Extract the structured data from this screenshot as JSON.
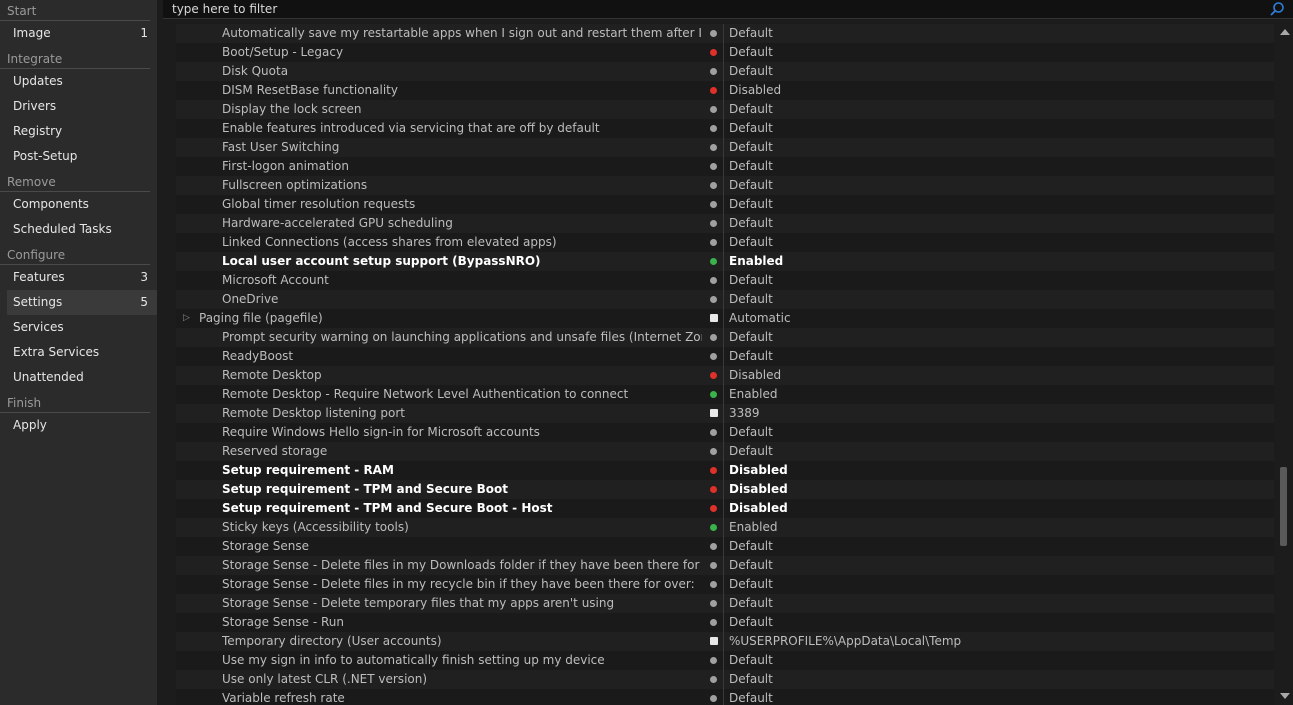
{
  "sidebar": {
    "groups": [
      {
        "header": "Start",
        "items": [
          {
            "label": "Image",
            "count": "1"
          }
        ]
      },
      {
        "header": "Integrate",
        "items": [
          {
            "label": "Updates"
          },
          {
            "label": "Drivers"
          },
          {
            "label": "Registry"
          },
          {
            "label": "Post-Setup"
          }
        ]
      },
      {
        "header": "Remove",
        "items": [
          {
            "label": "Components"
          },
          {
            "label": "Scheduled Tasks"
          }
        ]
      },
      {
        "header": "Configure",
        "items": [
          {
            "label": "Features",
            "count": "3"
          },
          {
            "label": "Settings",
            "count": "5",
            "active": true
          },
          {
            "label": "Services"
          },
          {
            "label": "Extra Services"
          },
          {
            "label": "Unattended"
          }
        ]
      },
      {
        "header": "Finish",
        "items": [
          {
            "label": "Apply"
          }
        ]
      }
    ]
  },
  "search": {
    "placeholder": "type here to filter"
  },
  "settings": [
    {
      "name": "Automatically save my restartable apps when I sign out and restart them after I sign",
      "status": "gray",
      "value": "Default"
    },
    {
      "name": "Boot/Setup - Legacy",
      "status": "red",
      "value": "Default"
    },
    {
      "name": "Disk Quota",
      "status": "gray",
      "value": "Default"
    },
    {
      "name": "DISM ResetBase functionality",
      "status": "red",
      "value": "Disabled"
    },
    {
      "name": "Display the lock screen",
      "status": "gray",
      "value": "Default"
    },
    {
      "name": "Enable features introduced via servicing that are off by default",
      "status": "gray",
      "value": "Default"
    },
    {
      "name": "Fast User Switching",
      "status": "gray",
      "value": "Default"
    },
    {
      "name": "First-logon animation",
      "status": "gray",
      "value": "Default"
    },
    {
      "name": "Fullscreen optimizations",
      "status": "gray",
      "value": "Default"
    },
    {
      "name": "Global timer resolution requests",
      "status": "gray",
      "value": "Default"
    },
    {
      "name": "Hardware-accelerated GPU scheduling",
      "status": "gray",
      "value": "Default"
    },
    {
      "name": "Linked Connections (access shares from elevated apps)",
      "status": "gray",
      "value": "Default"
    },
    {
      "name": "Local user account setup support (BypassNRO)",
      "status": "green",
      "value": "Enabled",
      "bold": true
    },
    {
      "name": "Microsoft Account",
      "status": "gray",
      "value": "Default"
    },
    {
      "name": "OneDrive",
      "status": "gray",
      "value": "Default"
    },
    {
      "name": "Paging file (pagefile)",
      "status": "edit",
      "value": "Automatic",
      "group": true
    },
    {
      "name": "Prompt security warning on launching applications and unsafe files (Internet Zone)",
      "status": "gray",
      "value": "Default"
    },
    {
      "name": "ReadyBoost",
      "status": "gray",
      "value": "Default"
    },
    {
      "name": "Remote Desktop",
      "status": "red",
      "value": "Disabled"
    },
    {
      "name": "Remote Desktop - Require Network Level Authentication to connect",
      "status": "green",
      "value": "Enabled"
    },
    {
      "name": "Remote Desktop listening port",
      "status": "edit",
      "value": "3389"
    },
    {
      "name": "Require Windows Hello sign-in for Microsoft accounts",
      "status": "gray",
      "value": "Default"
    },
    {
      "name": "Reserved storage",
      "status": "gray",
      "value": "Default"
    },
    {
      "name": "Setup requirement - RAM",
      "status": "red",
      "value": "Disabled",
      "bold": true
    },
    {
      "name": "Setup requirement - TPM and Secure Boot",
      "status": "red",
      "value": "Disabled",
      "bold": true
    },
    {
      "name": "Setup requirement - TPM and Secure Boot - Host",
      "status": "red",
      "value": "Disabled",
      "bold": true
    },
    {
      "name": "Sticky keys (Accessibility tools)",
      "status": "green",
      "value": "Enabled"
    },
    {
      "name": "Storage Sense",
      "status": "gray",
      "value": "Default"
    },
    {
      "name": "Storage Sense - Delete files in my Downloads folder if they have been there for over:",
      "status": "gray",
      "value": "Default"
    },
    {
      "name": "Storage Sense - Delete files in my recycle bin if they have been there for over:",
      "status": "gray",
      "value": "Default"
    },
    {
      "name": "Storage Sense - Delete temporary files that my apps aren't using",
      "status": "gray",
      "value": "Default"
    },
    {
      "name": "Storage Sense - Run",
      "status": "gray",
      "value": "Default"
    },
    {
      "name": "Temporary directory (User accounts)",
      "status": "edit",
      "value": "%USERPROFILE%\\AppData\\Local\\Temp"
    },
    {
      "name": "Use my sign in info to automatically finish setting up my device",
      "status": "gray",
      "value": "Default"
    },
    {
      "name": "Use only latest CLR (.NET version)",
      "status": "gray",
      "value": "Default"
    },
    {
      "name": "Variable refresh rate",
      "status": "gray",
      "value": "Default"
    }
  ],
  "colors": {
    "red": "#e0302a",
    "green": "#3ab34a",
    "gray": "#a0a0a0"
  },
  "scroll_position": 0.69
}
